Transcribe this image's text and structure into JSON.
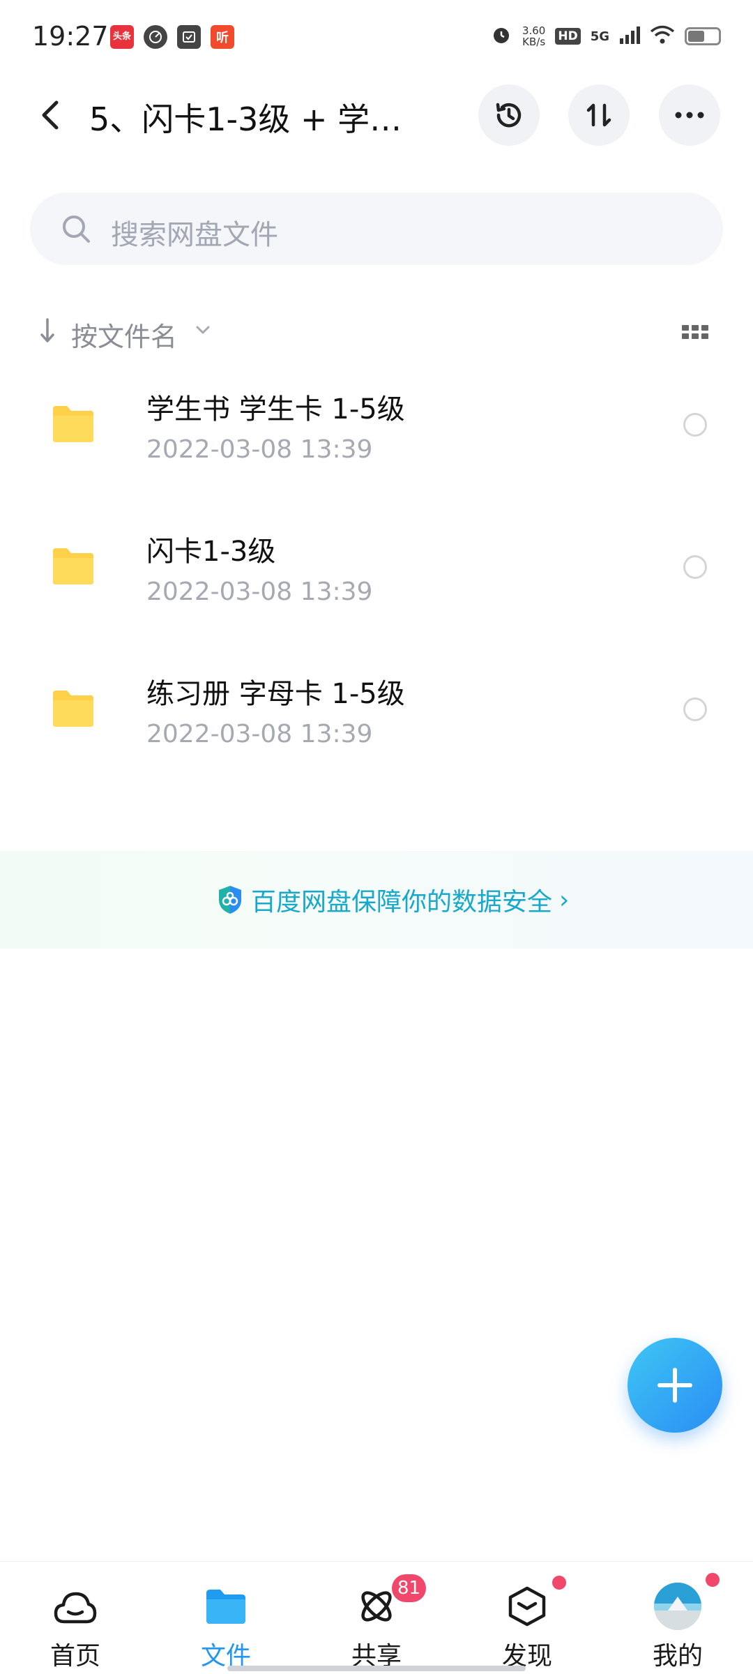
{
  "status_bar": {
    "time": "19:27",
    "notif_toutiao": "头条",
    "notif_ting": "听",
    "speed_value": "3.60",
    "speed_unit": "KB/s",
    "hd": "HD",
    "network": "5G",
    "battery_level": 0.55
  },
  "header": {
    "title": "5、闪卡1-3级 + 学…"
  },
  "search": {
    "placeholder": "搜索网盘文件"
  },
  "sort": {
    "label": "按文件名"
  },
  "files": [
    {
      "name": "学生书 学生卡 1-5级",
      "date": "2022-03-08  13:39"
    },
    {
      "name": "闪卡1-3级",
      "date": "2022-03-08  13:39"
    },
    {
      "name": "练习册 字母卡 1-5级",
      "date": "2022-03-08  13:39"
    }
  ],
  "security_banner": {
    "text": "百度网盘保障你的数据安全",
    "arrow": "›"
  },
  "bottom_nav": {
    "items": [
      {
        "label": "首页",
        "icon": "cloud-home-icon"
      },
      {
        "label": "文件",
        "icon": "folder-icon"
      },
      {
        "label": "共享",
        "icon": "share-orbit-icon",
        "badge": "81"
      },
      {
        "label": "发现",
        "icon": "discover-box-icon"
      },
      {
        "label": "我的",
        "icon": "avatar"
      }
    ],
    "active": "文件"
  },
  "colors": {
    "accent": "#2196f3",
    "folder": "#ffd04a",
    "badge": "#f0476a",
    "security_text": "#18a8c9"
  }
}
